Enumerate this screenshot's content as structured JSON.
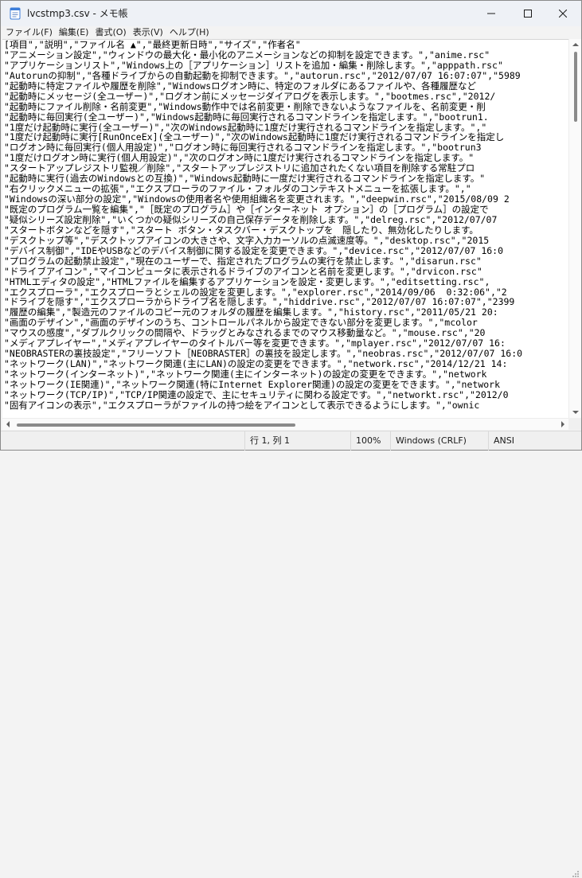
{
  "window": {
    "title": "lvcstmp3.csv - メモ帳",
    "icon": "notepad-icon"
  },
  "menu": [
    {
      "label": "ファイル(F)"
    },
    {
      "label": "編集(E)"
    },
    {
      "label": "書式(O)"
    },
    {
      "label": "表示(V)"
    },
    {
      "label": "ヘルプ(H)"
    }
  ],
  "editor": {
    "lines": [
      "[項目\",\"説明\",\"ファイル名 ▲\",\"最終更新日時\",\"サイズ\",\"作者名\"",
      "\"アニメーション設定\",\"ウィンドウの最大化・最小化のアニメーションなどの抑制を設定できます。\",\"anime.rsc\"",
      "\"アプリケーションリスト\",\"Windows上の［アプリケーション］リストを追加・編集・削除します。\",\"apppath.rsc\"",
      "\"Autorunの抑制\",\"各種ドライブからの自動起動を抑制できます。\",\"autorun.rsc\",\"2012/07/07 16:07:07\",\"5989",
      "\"起動時に特定ファイルや履歴を削除\",\"Windowsログオン時に、特定のフォルダにあるファイルや、各種履歴など",
      "\"起動時にメッセージ(全ユーザー)\",\"ログオン前にメッセージダイアログを表示します。\",\"bootmes.rsc\",\"2012/",
      "\"起動時にファイル削除・名前変更\",\"Windows動作中では名前変更・削除できないようなファイルを、名前変更・削",
      "\"起動時に毎回実行(全ユーザー)\",\"Windows起動時に毎回実行されるコマンドラインを指定します。\",\"bootrun1.",
      "\"1度だけ起動時に実行(全ユーザー)\",\"次のWindows起動時に1度だけ実行されるコマンドラインを指定します。\",\"",
      "\"1度だけ起動時に実行[RunOnceEx](全ユーザー)\",\"次のWindows起動時に1度だけ実行されるコマンドラインを指定し",
      "\"ログオン時に毎回実行(個人用設定)\",\"ログオン時に毎回実行されるコマンドラインを指定します。\",\"bootrun3",
      "\"1度だけログオン時に実行(個人用設定)\",\"次のログオン時に1度だけ実行されるコマンドラインを指定します。\"",
      "\"スタートアップレジストリ監視／削除\",\"スタートアップレジストリに追加されたくない項目を削除する常駐プロ",
      "\"起動時に実行(過去のWindowsとの互換)\",\"Windows起動時に一度だけ実行されるコマンドラインを指定します。\"",
      "\"右クリックメニューの拡張\",\"エクスプローラのファイル・フォルダのコンテキストメニューを拡張します。\",\"",
      "\"Windowsの深い部分の設定\",\"Windowsの使用者名や使用組織名を変更されます。\",\"deepwin.rsc\",\"2015/08/09 2",
      "\"既定のプログラム一覧を編集\",\"［既定のプログラム］や［インターネット オプション］の［プログラム］の設定で",
      "\"疑似シリーズ設定削除\",\"いくつかの疑似シリーズの自己保存データを削除します。\",\"delreg.rsc\",\"2012/07/07",
      "\"スタートボタンなどを隠す\",\"スタート ボタン・タスクバー・デスクトップを　隠したり、無効化したりします。",
      "\"デスクトップ等\",\"デスクトップアイコンの大きさや、文字入力カーソルの点滅速度等。\",\"desktop.rsc\",\"2015",
      "\"デバイス制御\",\"IDEやUSBなどのデバイス制御に関する設定を変更できます。\",\"device.rsc\",\"2012/07/07 16:0",
      "\"プログラムの起動禁止設定\",\"現在のユーザーで、指定されたプログラムの実行を禁止します。\",\"disarun.rsc\"",
      "\"ドライブアイコン\",\"マイコンピュータに表示されるドライブのアイコンと名前を変更します。\",\"drvicon.rsc\"",
      "\"HTMLエディタの設定\",\"HTMLファイルを編集するアプリケーションを設定・変更します。\",\"editsetting.rsc\",",
      "\"エクスプローラ\",\"エクスプローラとシェルの設定を変更します。\",\"explorer.rsc\",\"2014/09/06  0:32:06\",\"2",
      "\"ドライブを隠す\",\"エクスプローラからドライブ名を隠します。\",\"hiddrive.rsc\",\"2012/07/07 16:07:07\",\"2399",
      "\"履歴の編集\",\"製造元のファイルのコピー元のフォルダの履歴を編集します。\",\"history.rsc\",\"2011/05/21 20:",
      "\"画面のデザイン\",\"画面のデザインのうち、コントロールパネルから設定できない部分を変更します。\",\"mcolor",
      "\"マウスの感度\",\"ダブルクリックの間隔や、ドラッグとみなされるまでのマウス移動量など。\",\"mouse.rsc\",\"20",
      "\"メディアプレイヤー\",\"メディアプレイヤーのタイトルバー等を変更できます。\",\"mplayer.rsc\",\"2012/07/07 16:",
      "\"NEOBRASTERの裏技設定\",\"フリーソフト［NEOBRASTER］の裏技を設定します。\",\"neobras.rsc\",\"2012/07/07 16:0",
      "\"ネットワーク(LAN)\",\"ネットワーク関連(主にLAN)の設定の変更をできます。\",\"network.rsc\",\"2014/12/21 14:",
      "\"ネットワーク(インターネット)\",\"ネットワーク関連(主にインターネット)の設定の変更をできます。\",\"network",
      "\"ネットワーク(IE関連)\",\"ネットワーク関連(特にInternet Explorer関連)の設定の変更をできます。\",\"network",
      "\"ネットワーク(TCP/IP)\",\"TCP/IP関連の設定で、主にセキュリティに関わる設定です。\",\"networkt.rsc\",\"2012/0",
      "\"固有アイコンの表示\",\"エクスプローラがファイルの持つ絵をアイコンとして表示できるようにします。\",\"ownic"
    ]
  },
  "status": {
    "position": "行 1, 列 1",
    "zoom": "100%",
    "line_ending": "Windows (CRLF)",
    "encoding": "ANSI"
  }
}
